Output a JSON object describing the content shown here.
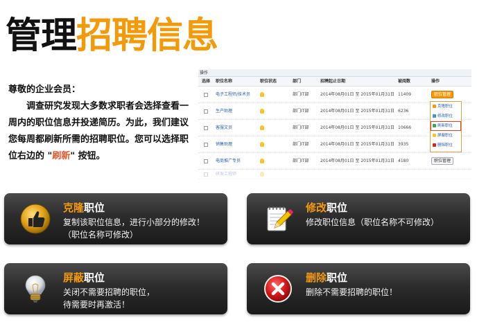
{
  "title": {
    "part1": "管理",
    "part2": "招聘信息"
  },
  "intro": {
    "salutation": "尊敬的企业会员：",
    "para_before": "调查研究发现大多数求职者会选择查看一周内的职位信息并投递简历。为此，我们建议您每周都刷新所需的招聘职位。您可以选择职位右边的 \"",
    "para_highlight": "刷新",
    "para_after": "\" 按钮。"
  },
  "table": {
    "ops_label": "操作",
    "headers": [
      "选择",
      "职位名称",
      "职位状态",
      "部门",
      "招聘起止日期",
      "被阅数",
      "操作"
    ],
    "rows": [
      {
        "name": "电子工程师/技术员",
        "dept": "部门IT部",
        "dates": "2014年08月01日 至 2015年01月31日",
        "views": "11409",
        "action": "职位管理"
      },
      {
        "name": "生产助理",
        "dept": "部门IT部",
        "dates": "2014年08月01日 至 2015年01月31日",
        "views": "6236",
        "action": ""
      },
      {
        "name": "客服文员",
        "dept": "部门IT部",
        "dates": "2014年08月01日 至 2015年01月31日",
        "views": "10666",
        "action": ""
      },
      {
        "name": "销售助理",
        "dept": "部门IT部",
        "dates": "2014年08月01日 至 2015年01月31日",
        "views": "3935",
        "action": ""
      },
      {
        "name": "电商推广专员",
        "dept": "部门IT部",
        "dates": "2014年08月01日 至 2015年01月31日",
        "views": "4180",
        "action": "职位管理"
      },
      {
        "name": "研发工程师",
        "dept": "",
        "dates": "",
        "views": "",
        "action": ""
      }
    ],
    "menu": [
      "克隆职位",
      "修改职位",
      "刷新职位",
      "屏蔽职位",
      "删除职位"
    ],
    "colors": {
      "accent": "#f39a0a",
      "link": "#2a5db0"
    }
  },
  "cards": {
    "clone": {
      "hl": "克隆",
      "rest": "职位",
      "line1": "复制该职位信息，进行小部分的修改！",
      "line2": "（职位名称可修改）",
      "icon": "thumbs-up-icon"
    },
    "edit": {
      "hl": "修改",
      "rest": "职位",
      "line1": "修改职位信息（职位名称不可修改）",
      "icon": "notepad-pencil-icon"
    },
    "block": {
      "hl": "屏蔽",
      "rest": "职位",
      "line1": "关闭不需要招聘的职位，",
      "line2": "待需要时再激活！",
      "icon": "lightbulb-icon"
    },
    "delete": {
      "hl": "删除",
      "rest": "职位",
      "line1": "删除不需要招聘的职位！",
      "icon": "red-x-icon"
    }
  }
}
